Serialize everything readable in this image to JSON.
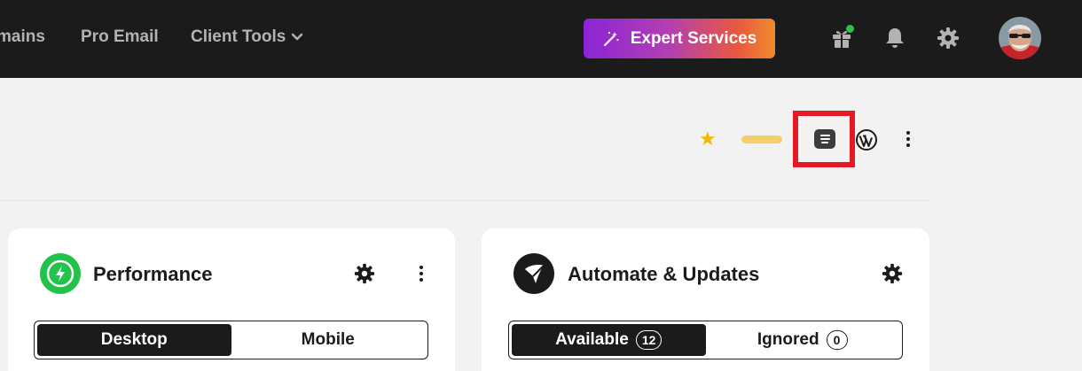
{
  "nav": {
    "domains": "mains",
    "pro_email": "Pro Email",
    "client_tools": "Client Tools",
    "expert_services": "Expert Services"
  },
  "icons": {
    "wand": "magic-wand-icon",
    "gift": "gift-icon",
    "bell": "bell-icon",
    "settings": "gear-icon",
    "notes": "notes-icon",
    "wordpress": "wordpress-icon",
    "favorite": "star-icon"
  },
  "colors": {
    "topbar": "#1b1b1b",
    "star": "#f5b800",
    "notification_dot": "#2ec04f",
    "highlight": "#e41a26",
    "performance_icon": "#22c24b"
  },
  "performance": {
    "title": "Performance",
    "tabs": [
      "Desktop",
      "Mobile"
    ],
    "selected_tab": "Desktop"
  },
  "automate": {
    "title": "Automate & Updates",
    "tabs": [
      {
        "label": "Available",
        "count": "12"
      },
      {
        "label": "Ignored",
        "count": "0"
      }
    ],
    "selected_tab": "Available"
  }
}
